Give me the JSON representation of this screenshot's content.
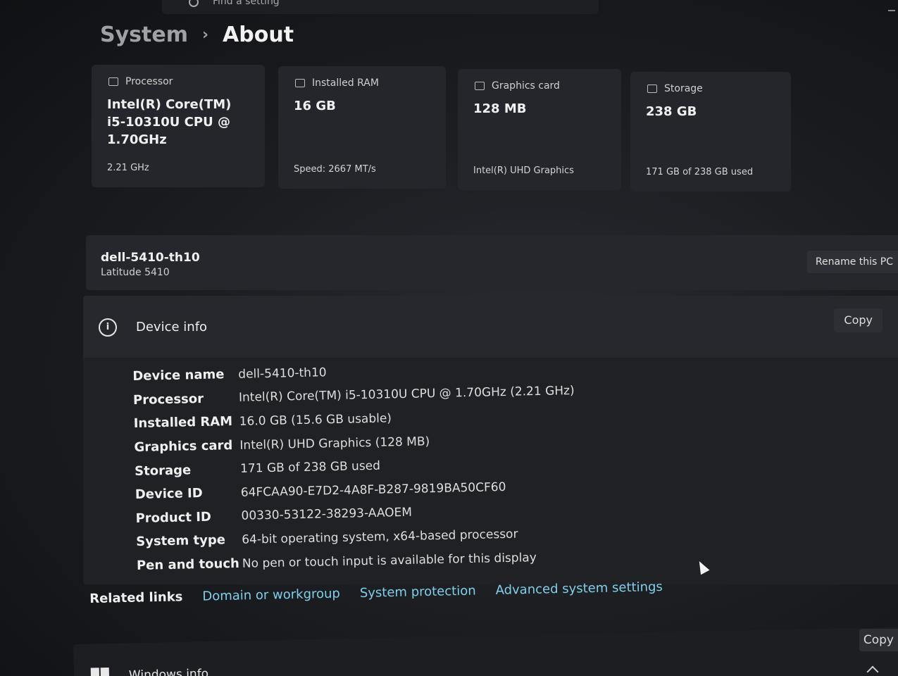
{
  "search": {
    "placeholder": "Find a setting"
  },
  "breadcrumb": {
    "parent": "System",
    "separator": "›",
    "current": "About"
  },
  "cards": [
    {
      "icon": "processor-icon",
      "label": "Processor",
      "value": "Intel(R) Core(TM) i5-10310U CPU @ 1.70GHz",
      "sub": "2.21 GHz"
    },
    {
      "icon": "ram-icon",
      "label": "Installed RAM",
      "value": "16 GB",
      "sub": "Speed: 2667 MT/s"
    },
    {
      "icon": "graphics-card-icon",
      "label": "Graphics card",
      "value": "128 MB",
      "sub": "Intel(R) UHD Graphics"
    },
    {
      "icon": "storage-icon",
      "label": "Storage",
      "value": "238 GB",
      "sub": "171 GB of 238 GB used"
    }
  ],
  "pc": {
    "name": "dell-5410-th10",
    "model": "Latitude 5410",
    "rename_label": "Rename this PC"
  },
  "device_info": {
    "title": "Device info",
    "copy_label": "Copy",
    "specs": [
      {
        "label": "Device name",
        "value": "dell-5410-th10"
      },
      {
        "label": "Processor",
        "value": "Intel(R) Core(TM) i5-10310U CPU @ 1.70GHz (2.21 GHz)"
      },
      {
        "label": "Installed RAM",
        "value": "16.0 GB (15.6 GB usable)"
      },
      {
        "label": "Graphics card",
        "value": "Intel(R) UHD Graphics (128 MB)"
      },
      {
        "label": "Storage",
        "value": "171 GB of 238 GB used"
      },
      {
        "label": "Device ID",
        "value": "64FCAA90-E7D2-4A8F-B287-9819BA50CF60"
      },
      {
        "label": "Product ID",
        "value": "00330-53122-38293-AAOEM"
      },
      {
        "label": "System type",
        "value": "64-bit operating system, x64-based processor"
      },
      {
        "label": "Pen and touch",
        "value": "No pen or touch input is available for this display"
      }
    ]
  },
  "related_links": {
    "label": "Related links",
    "links": [
      "Domain or workgroup",
      "System protection",
      "Advanced system settings"
    ]
  },
  "windows_info": {
    "title": "Windows info",
    "copy_label": "Copy"
  }
}
